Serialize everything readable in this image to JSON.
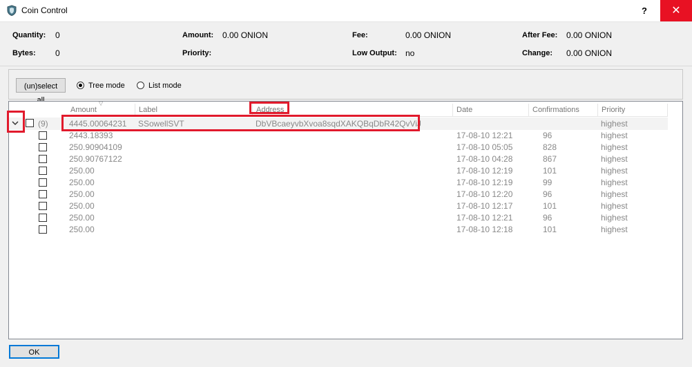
{
  "window": {
    "title": "Coin Control",
    "help_label": "?",
    "close_label": "✕"
  },
  "summary": {
    "quantity_label": "Quantity:",
    "quantity_value": "0",
    "bytes_label": "Bytes:",
    "bytes_value": "0",
    "amount_label": "Amount:",
    "amount_value": "0.00 ONION",
    "priority_label": "Priority:",
    "priority_value": "",
    "fee_label": "Fee:",
    "fee_value": "0.00 ONION",
    "low_output_label": "Low Output:",
    "low_output_value": "no",
    "after_fee_label": "After Fee:",
    "after_fee_value": "0.00 ONION",
    "change_label": "Change:",
    "change_value": "0.00 ONION"
  },
  "toolbar": {
    "select_all_label": "(un)select all",
    "tree_mode_label": "Tree mode",
    "list_mode_label": "List mode",
    "selected_mode": "tree"
  },
  "columns": [
    "Amount",
    "Label",
    "Address",
    "Date",
    "Confirmations",
    "Priority"
  ],
  "parent": {
    "count": "(9)",
    "amount": "4445.00064231",
    "label": "SSowellSVT",
    "address": "DbVBcaeyvbXvoa8sqdXAKQBqDbR42QvViJ",
    "priority": "highest"
  },
  "rows": [
    {
      "amount": "2443.18393",
      "date": "17-08-10 12:21",
      "confirmations": "96",
      "priority": "highest"
    },
    {
      "amount": "250.90904109",
      "date": "17-08-10 05:05",
      "confirmations": "828",
      "priority": "highest"
    },
    {
      "amount": "250.90767122",
      "date": "17-08-10 04:28",
      "confirmations": "867",
      "priority": "highest"
    },
    {
      "amount": "250.00",
      "date": "17-08-10 12:19",
      "confirmations": "101",
      "priority": "highest"
    },
    {
      "amount": "250.00",
      "date": "17-08-10 12:19",
      "confirmations": "99",
      "priority": "highest"
    },
    {
      "amount": "250.00",
      "date": "17-08-10 12:20",
      "confirmations": "96",
      "priority": "highest"
    },
    {
      "amount": "250.00",
      "date": "17-08-10 12:17",
      "confirmations": "101",
      "priority": "highest"
    },
    {
      "amount": "250.00",
      "date": "17-08-10 12:21",
      "confirmations": "96",
      "priority": "highest"
    },
    {
      "amount": "250.00",
      "date": "17-08-10 12:18",
      "confirmations": "101",
      "priority": "highest"
    }
  ],
  "footer": {
    "ok_label": "OK"
  },
  "colors": {
    "highlight": "#e11a2c",
    "close_bg": "#e81123",
    "ok_border": "#0078d7"
  }
}
